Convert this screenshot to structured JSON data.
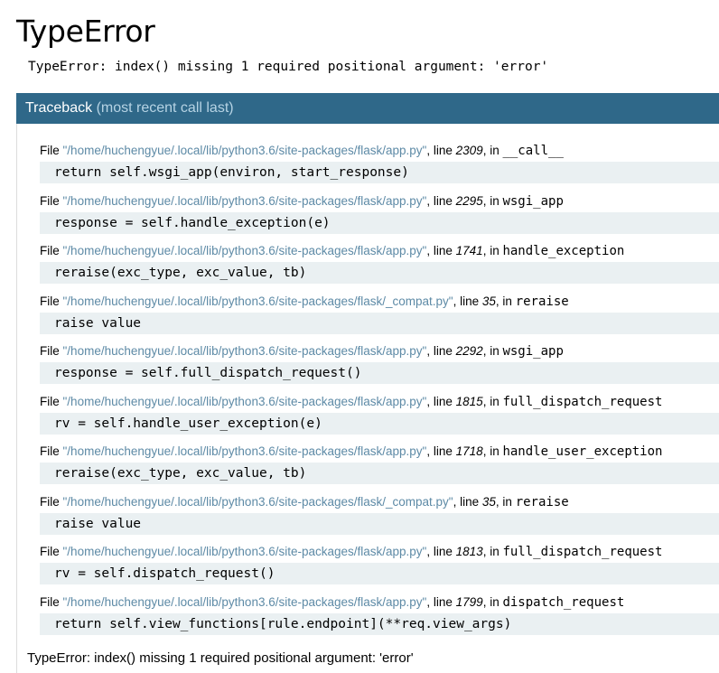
{
  "title": "TypeError",
  "error_message": "TypeError: index() missing 1 required positional argument: 'error'",
  "traceback": {
    "label": "Traceback",
    "sublabel": "(most recent call last)",
    "frames": [
      {
        "file": "\"/home/huchengyue/.local/lib/python3.6/site-packages/flask/app.py\"",
        "line": "2309",
        "func": "__call__",
        "code": "return self.wsgi_app(environ, start_response)"
      },
      {
        "file": "\"/home/huchengyue/.local/lib/python3.6/site-packages/flask/app.py\"",
        "line": "2295",
        "func": "wsgi_app",
        "code": "response = self.handle_exception(e)"
      },
      {
        "file": "\"/home/huchengyue/.local/lib/python3.6/site-packages/flask/app.py\"",
        "line": "1741",
        "func": "handle_exception",
        "code": "reraise(exc_type, exc_value, tb)"
      },
      {
        "file": "\"/home/huchengyue/.local/lib/python3.6/site-packages/flask/_compat.py\"",
        "line": "35",
        "func": "reraise",
        "code": "raise value"
      },
      {
        "file": "\"/home/huchengyue/.local/lib/python3.6/site-packages/flask/app.py\"",
        "line": "2292",
        "func": "wsgi_app",
        "code": "response = self.full_dispatch_request()"
      },
      {
        "file": "\"/home/huchengyue/.local/lib/python3.6/site-packages/flask/app.py\"",
        "line": "1815",
        "func": "full_dispatch_request",
        "code": "rv = self.handle_user_exception(e)"
      },
      {
        "file": "\"/home/huchengyue/.local/lib/python3.6/site-packages/flask/app.py\"",
        "line": "1718",
        "func": "handle_user_exception",
        "code": "reraise(exc_type, exc_value, tb)"
      },
      {
        "file": "\"/home/huchengyue/.local/lib/python3.6/site-packages/flask/_compat.py\"",
        "line": "35",
        "func": "reraise",
        "code": "raise value"
      },
      {
        "file": "\"/home/huchengyue/.local/lib/python3.6/site-packages/flask/app.py\"",
        "line": "1813",
        "func": "full_dispatch_request",
        "code": "rv = self.dispatch_request()"
      },
      {
        "file": "\"/home/huchengyue/.local/lib/python3.6/site-packages/flask/app.py\"",
        "line": "1799",
        "func": "dispatch_request",
        "code": "return self.view_functions[rule.endpoint](**req.view_args)"
      }
    ],
    "final_error": "TypeError: index() missing 1 required positional argument: 'error'"
  },
  "labels": {
    "file_prefix": "File ",
    "line_prefix": ", line ",
    "in_prefix": ", in "
  },
  "colors": {
    "header_bg": "#2f6889",
    "header_sub": "#b6d3e4",
    "path": "#5d8aa6",
    "code_bg": "#eaf0f2"
  }
}
